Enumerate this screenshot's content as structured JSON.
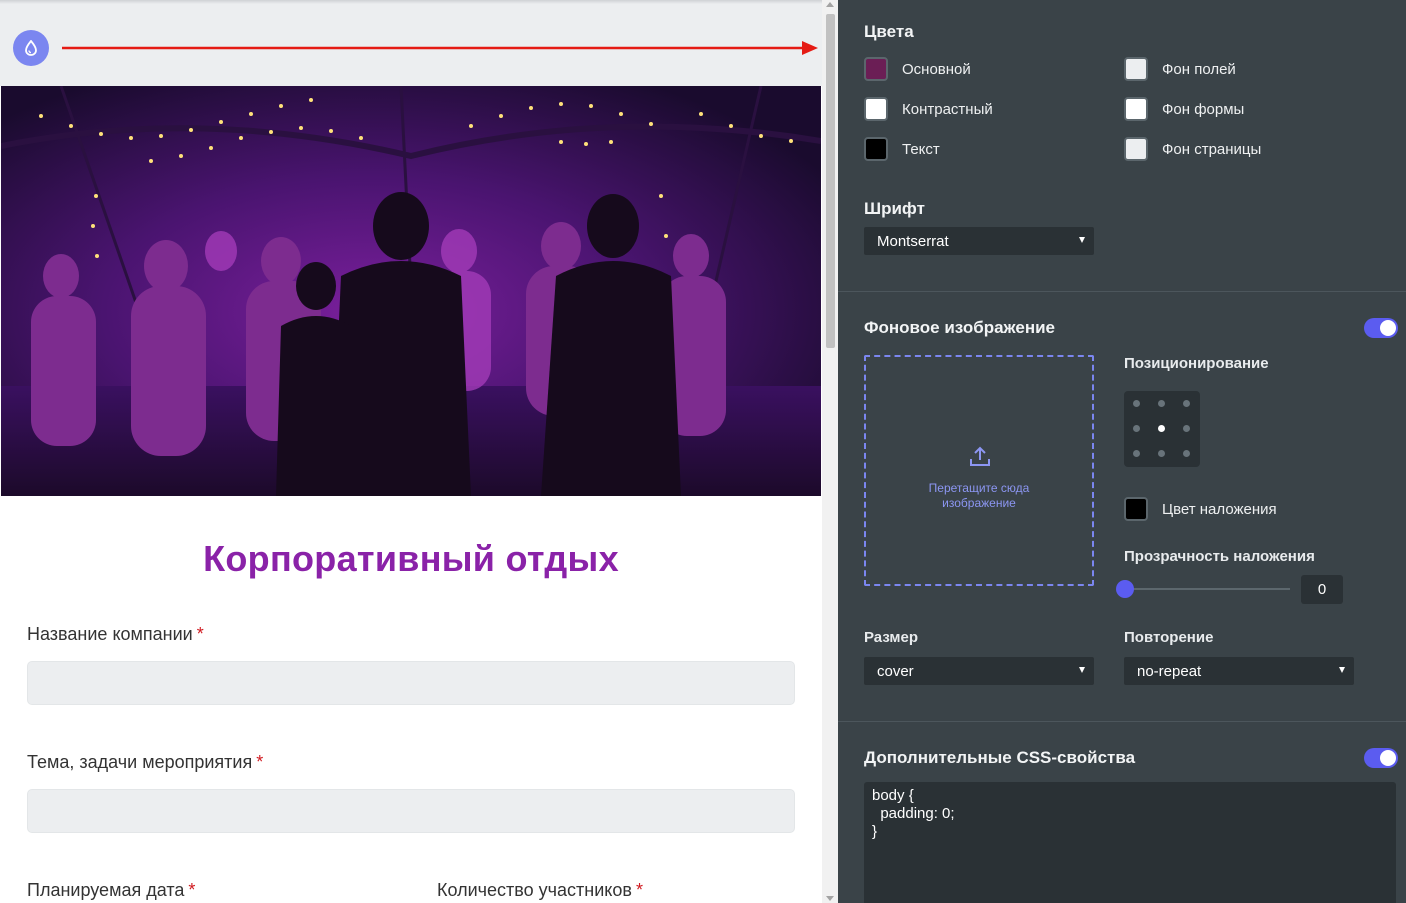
{
  "preview": {
    "form_title": "Корпоративный отдых",
    "fields": [
      {
        "label": "Название компании",
        "required_mark": "*"
      },
      {
        "label": "Тема, задачи мероприятия",
        "required_mark": "*"
      },
      {
        "label": "Планируемая дата",
        "required_mark": "*"
      },
      {
        "label": "Количество участников",
        "required_mark": "*"
      }
    ],
    "theme_button_icon": "drop-icon",
    "accent_color": "#8a22a8"
  },
  "settings": {
    "colors": {
      "title": "Цвета",
      "items": [
        {
          "label": "Основной",
          "color": "#6b1e55"
        },
        {
          "label": "Контрастный",
          "color": "#ffffff"
        },
        {
          "label": "Текст",
          "color": "#000000"
        },
        {
          "label": "Фон полей",
          "color": "#eceef0"
        },
        {
          "label": "Фон формы",
          "color": "#ffffff"
        },
        {
          "label": "Фон страницы",
          "color": "#eceef0"
        }
      ]
    },
    "font": {
      "title": "Шрифт",
      "value": "Montserrat"
    },
    "background_image": {
      "title": "Фоновое изображение",
      "enabled": true,
      "dropzone_hint_line1": "Перетащите сюда",
      "dropzone_hint_line2": "изображение",
      "positioning_title": "Позиционирование",
      "position_selected": "center",
      "overlay_color_label": "Цвет наложения",
      "overlay_color": "#000000",
      "overlay_opacity_title": "Прозрачность наложения",
      "overlay_opacity_value": "0",
      "size_title": "Размер",
      "size_value": "cover",
      "repeat_title": "Повторение",
      "repeat_value": "no-repeat"
    },
    "custom_css": {
      "title": "Дополнительные CSS-свойства",
      "enabled": true,
      "code": "body {\n  padding: 0;\n}"
    },
    "toggle_color": "#5b5cf0"
  }
}
